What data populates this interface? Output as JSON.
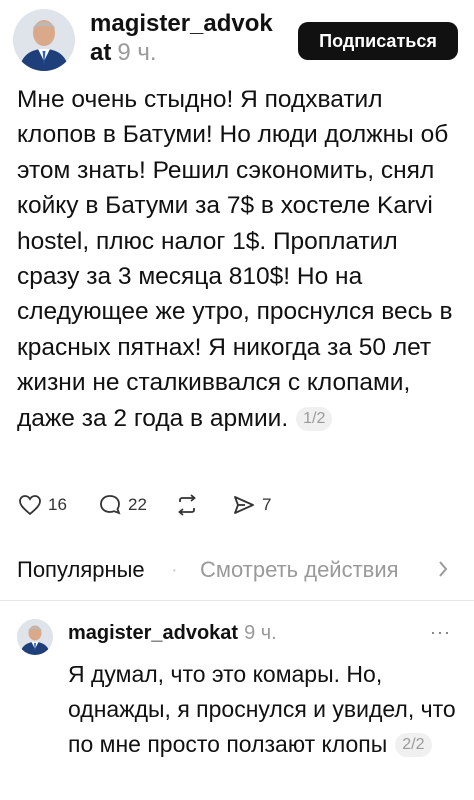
{
  "post": {
    "username": "magister_advok at",
    "time": "9 ч.",
    "subscribe_label": "Подписаться",
    "text": "Мне очень стыдно! Я подхватил клопов в Батуми! Но люди должны об этом знать! Решил сэкономить, снял койку в Батуми за 7$ в хостеле Karvi hostel, плюс налог 1$. Проплатил сразу за 3 месяца 810$! Но на следующее же утро, проснулся весь в красных пятнах! Я никогда за 50 лет жизни не сталкиввался с клопами, даже за 2 года в армии.",
    "pager": "1/2",
    "likes": "16",
    "comments": "22",
    "shares": "7"
  },
  "tabs": {
    "popular": "Популярные",
    "see_actions": "Смотреть действия"
  },
  "reply": {
    "username": "magister_advokat",
    "time": "9 ч.",
    "more": "···",
    "text": "Я думал, что это комары. Но, однажды, я проснулся и увидел, что по мне просто ползают клопы",
    "pager": "2/2"
  },
  "icons": {
    "like": "heart-icon",
    "comment": "comment-icon",
    "repost": "repost-icon",
    "share": "share-icon",
    "chevron": "chevron-right-icon"
  },
  "colors": {
    "subscribe_bg": "#111111",
    "muted": "#9a9a9a"
  }
}
